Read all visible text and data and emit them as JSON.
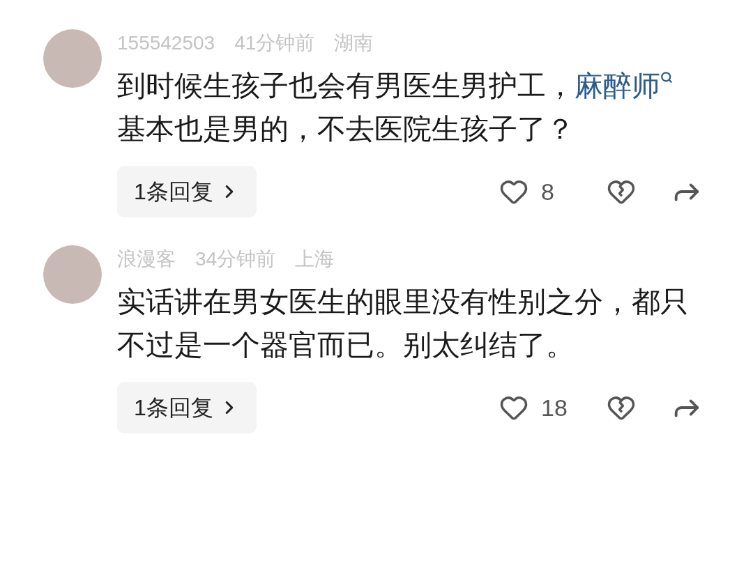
{
  "comments": [
    {
      "meta": [
        "155542503",
        "41分钟前",
        "湖南"
      ],
      "body": [
        {
          "kind": "text",
          "text": "到时候生孩子也会有男医生男护工，"
        },
        {
          "kind": "link",
          "text": "麻醉师"
        },
        {
          "kind": "text",
          "text": "基本也是男的，不去医院生孩子了？"
        }
      ],
      "replies": "1条回复",
      "likes": "8"
    },
    {
      "meta": [
        "浪漫客",
        "34分钟前",
        "上海"
      ],
      "body": [
        {
          "kind": "text",
          "text": "实话讲在男女医生的眼里没有性别之分，都只不过是一个器官而已。别太纠结了。"
        }
      ],
      "replies": "1条回复",
      "likes": "18"
    }
  ]
}
